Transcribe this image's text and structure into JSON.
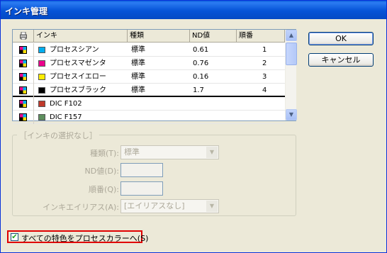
{
  "window": {
    "title": "インキ管理"
  },
  "colors": {
    "title_bar": "#0553d7",
    "highlight_border": "#e00000",
    "disabled_text": "#aca899"
  },
  "ink_list": {
    "columns": [
      "",
      "インキ",
      "種類",
      "ND値",
      "順番"
    ],
    "header_icon": "printer-icon",
    "rows": [
      {
        "icon": "cmyk-process-icon",
        "swatch": "#00aeef",
        "name": "プロセスシアン",
        "type": "標準",
        "nd": "0.61",
        "order": "1"
      },
      {
        "icon": "cmyk-process-icon",
        "swatch": "#ec008c",
        "name": "プロセスマゼンタ",
        "type": "標準",
        "nd": "0.76",
        "order": "2"
      },
      {
        "icon": "cmyk-process-icon",
        "swatch": "#ffed00",
        "name": "プロセスイエロー",
        "type": "標準",
        "nd": "0.16",
        "order": "3"
      },
      {
        "icon": "cmyk-process-icon",
        "swatch": "#000000",
        "name": "プロセスブラック",
        "type": "標準",
        "nd": "1.7",
        "order": "4"
      },
      {
        "icon": "cmyk-process-icon",
        "swatch": "#c0392b",
        "name": "DIC F102",
        "type": "",
        "nd": "",
        "order": ""
      },
      {
        "icon": "cmyk-process-icon",
        "swatch": "#5e8f5e",
        "name": "DIC F157",
        "type": "",
        "nd": "",
        "order": ""
      }
    ]
  },
  "buttons": {
    "ok": "OK",
    "cancel": "キャンセル"
  },
  "selection_group": {
    "title": "［インキの選択なし］",
    "type_label": "種類(T):",
    "type_value": "標準",
    "nd_label": "ND値(D):",
    "nd_value": "",
    "order_label": "順番(Q):",
    "order_value": "",
    "alias_label": "インキエイリアス(A):",
    "alias_value": "[エイリアスなし]"
  },
  "spot_to_process": {
    "label": "すべての特色をプロセスカラーへ(S)",
    "checked": true
  }
}
